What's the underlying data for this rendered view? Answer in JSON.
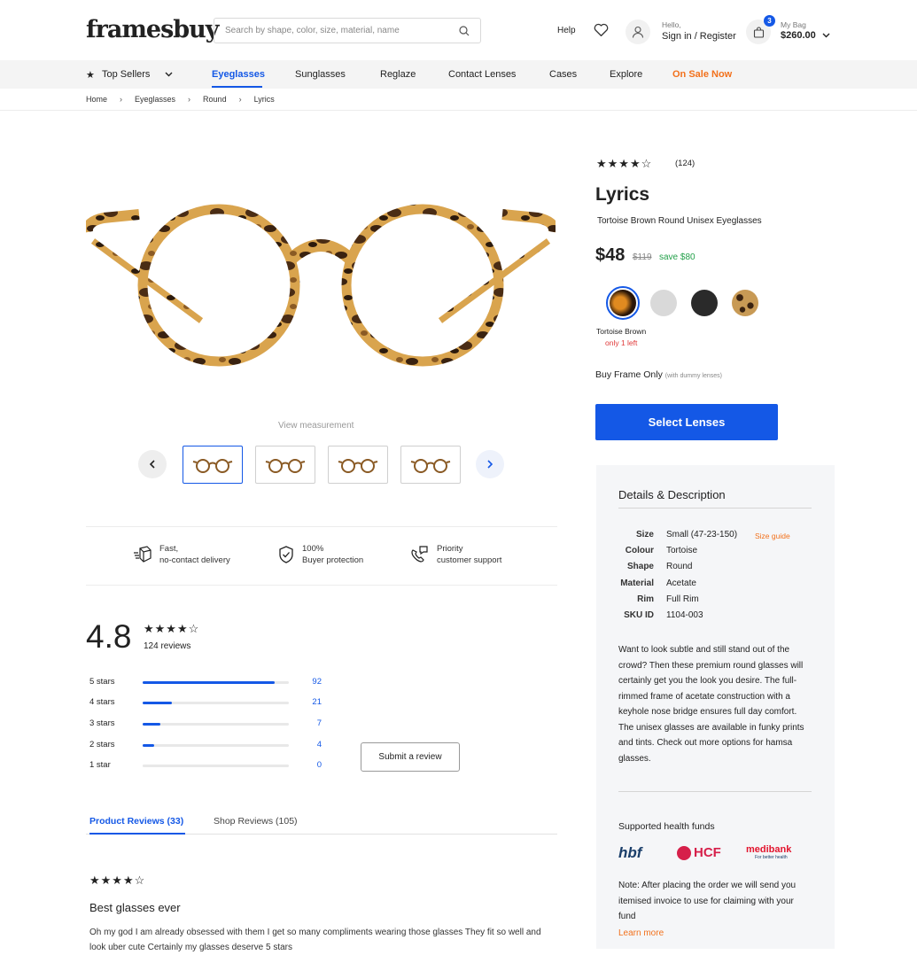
{
  "header": {
    "logo": "framesbuy",
    "search_placeholder": "Search by shape, color, size, material, name",
    "help": "Help",
    "hello": "Hello,",
    "sign_in": "Sign in / Register",
    "bag_count": "3",
    "bag_label": "My Bag",
    "bag_total": "$260.00"
  },
  "nav": {
    "items": [
      {
        "label": "Top Sellers"
      },
      {
        "label": "Eyeglasses"
      },
      {
        "label": "Sunglasses"
      },
      {
        "label": "Reglaze"
      },
      {
        "label": "Contact Lenses"
      },
      {
        "label": "Cases"
      },
      {
        "label": "Explore"
      },
      {
        "label": "On Sale Now"
      }
    ],
    "active": "Eyeglasses"
  },
  "breadcrumb": [
    "Home",
    "Eyeglasses",
    "Round",
    "Lyrics"
  ],
  "gallery": {
    "view_measurement": "View measurement",
    "thumbnail_count": 4,
    "selected_index": 0
  },
  "features": [
    {
      "line1": "Fast,",
      "line2": "no-contact delivery",
      "icon": "delivery-icon"
    },
    {
      "line1": "100%",
      "line2": "Buyer protection",
      "icon": "shield-check-icon"
    },
    {
      "line1": "Priority",
      "line2": "customer support",
      "icon": "phone-chat-icon"
    }
  ],
  "product": {
    "rating_stars": 4,
    "review_count": "(124)",
    "name": "Lyrics",
    "description": "Tortoise Brown Round Unisex Eyeglasses",
    "price": "$48",
    "old_price": "$119",
    "save": "save $80",
    "colors": [
      {
        "name": "Tortoise Brown",
        "hex": "#b8772a",
        "selected": true
      },
      {
        "name": "Grey",
        "hex": "#d9d9d9"
      },
      {
        "name": "Black",
        "hex": "#2a2a2a"
      },
      {
        "name": "Leopard",
        "hex": "#c89a55"
      }
    ],
    "selected_color": "Tortoise Brown",
    "stock_note": "only 1 left",
    "buy_frame_only": "Buy Frame Only",
    "buy_frame_note": "(with dummy lenses)",
    "select_lenses": "Select Lenses"
  },
  "details": {
    "heading": "Details & Description",
    "specs": [
      {
        "key": "Size",
        "value": "Small (47-23-150)"
      },
      {
        "key": "Colour",
        "value": "Tortoise"
      },
      {
        "key": "Shape",
        "value": "Round"
      },
      {
        "key": "Material",
        "value": "Acetate"
      },
      {
        "key": "Rim",
        "value": "Full Rim"
      },
      {
        "key": "SKU ID",
        "value": "1104-003"
      }
    ],
    "size_guide": "Size guide",
    "description": "Want to look subtle and still stand out of the crowd? Then these premium round glasses will certainly get you the look you desire. The full-rimmed frame of acetate construction with a keyhole nose bridge ensures full day comfort. The unisex glasses are available in funky prints and tints. Check out more options for hamsa glasses.",
    "health_funds_heading": "Supported health funds",
    "health_funds": [
      "hbf",
      "HCF",
      "medibank"
    ],
    "medibank_tag": "For better health",
    "note": "Note: After placing the order we will send you itemised invoice to use for claiming with your fund",
    "learn_more": "Learn more"
  },
  "reviews": {
    "average": "4.8",
    "stars": 4,
    "total": "124 reviews",
    "breakdown": [
      {
        "label": "5 stars",
        "count": "92",
        "fraction": 0.9
      },
      {
        "label": "4 stars",
        "count": "21",
        "fraction": 0.2
      },
      {
        "label": "3 stars",
        "count": "7",
        "fraction": 0.12
      },
      {
        "label": "2 stars",
        "count": "4",
        "fraction": 0.08
      },
      {
        "label": "1 star",
        "count": "0",
        "fraction": 0
      }
    ],
    "submit_review": "Submit a review",
    "tabs": [
      "Product Reviews (33)",
      "Shop Reviews (105)"
    ],
    "active_tab": 0,
    "first_review": {
      "stars": 4,
      "title": "Best glasses ever",
      "body": "Oh my god I am already obsessed with them I get so many compliments wearing those glasses They fit so well and look uber cute Certainly my glasses deserve 5 stars"
    }
  }
}
